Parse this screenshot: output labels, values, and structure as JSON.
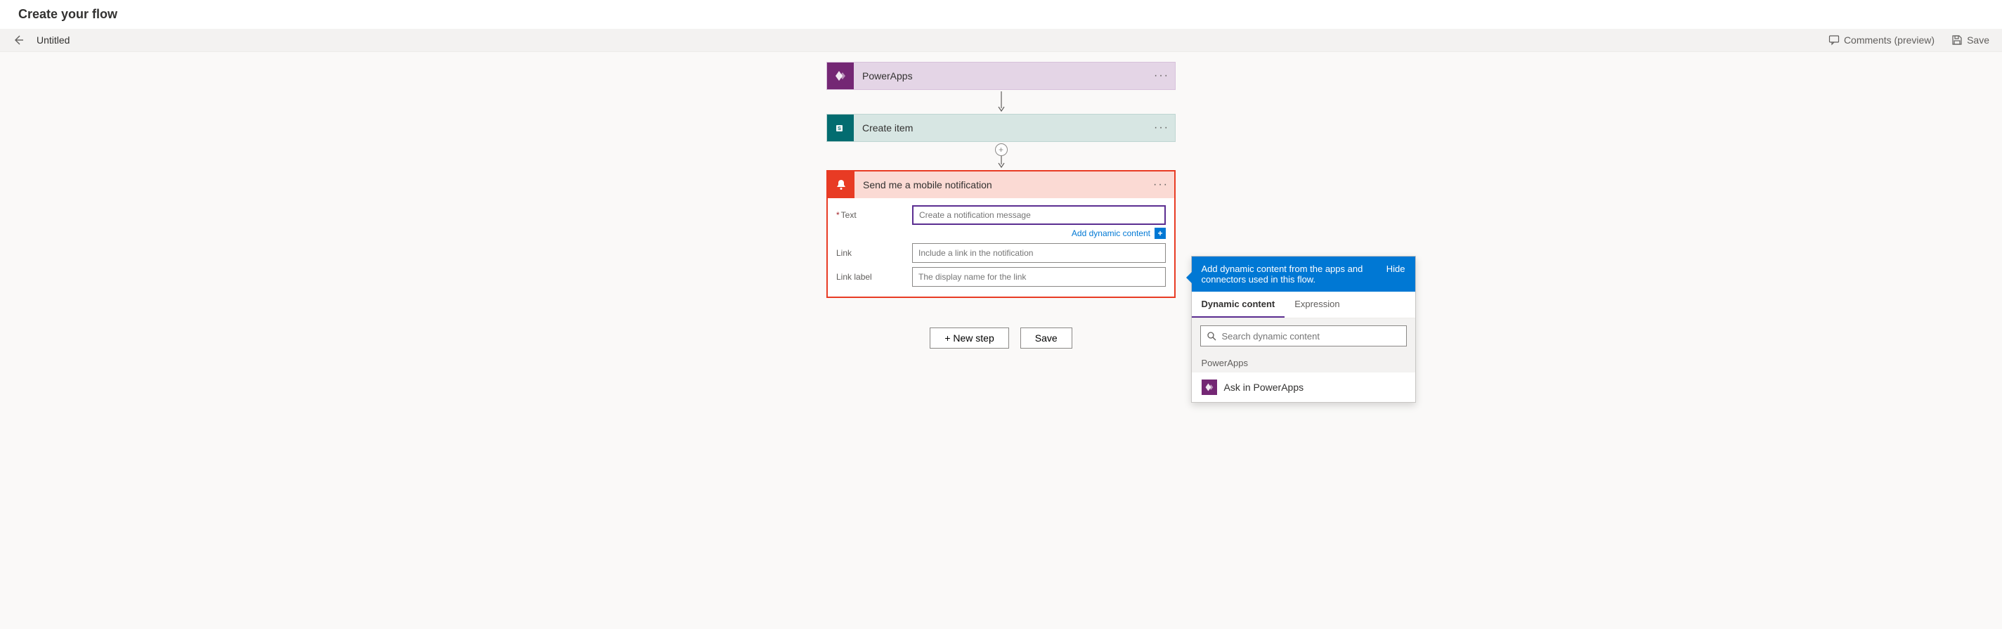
{
  "header": {
    "title": "Create your flow",
    "flow_name": "Untitled",
    "comments_label": "Comments (preview)",
    "save_label": "Save"
  },
  "steps": {
    "powerapps_label": "PowerApps",
    "create_item_label": "Create item",
    "notification": {
      "title": "Send me a mobile notification",
      "fields": {
        "text_label": "Text",
        "text_placeholder": "Create a notification message",
        "link_label": "Link",
        "link_placeholder": "Include a link in the notification",
        "link_label_label": "Link label",
        "link_label_placeholder": "The display name for the link"
      },
      "add_dynamic_label": "Add dynamic content"
    }
  },
  "buttons": {
    "new_step": "+ New step",
    "save": "Save"
  },
  "dynamic_panel": {
    "description": "Add dynamic content from the apps and connectors used in this flow.",
    "hide_label": "Hide",
    "tab_dynamic": "Dynamic content",
    "tab_expression": "Expression",
    "search_placeholder": "Search dynamic content",
    "group_powerapps": "PowerApps",
    "item_ask": "Ask in PowerApps"
  }
}
